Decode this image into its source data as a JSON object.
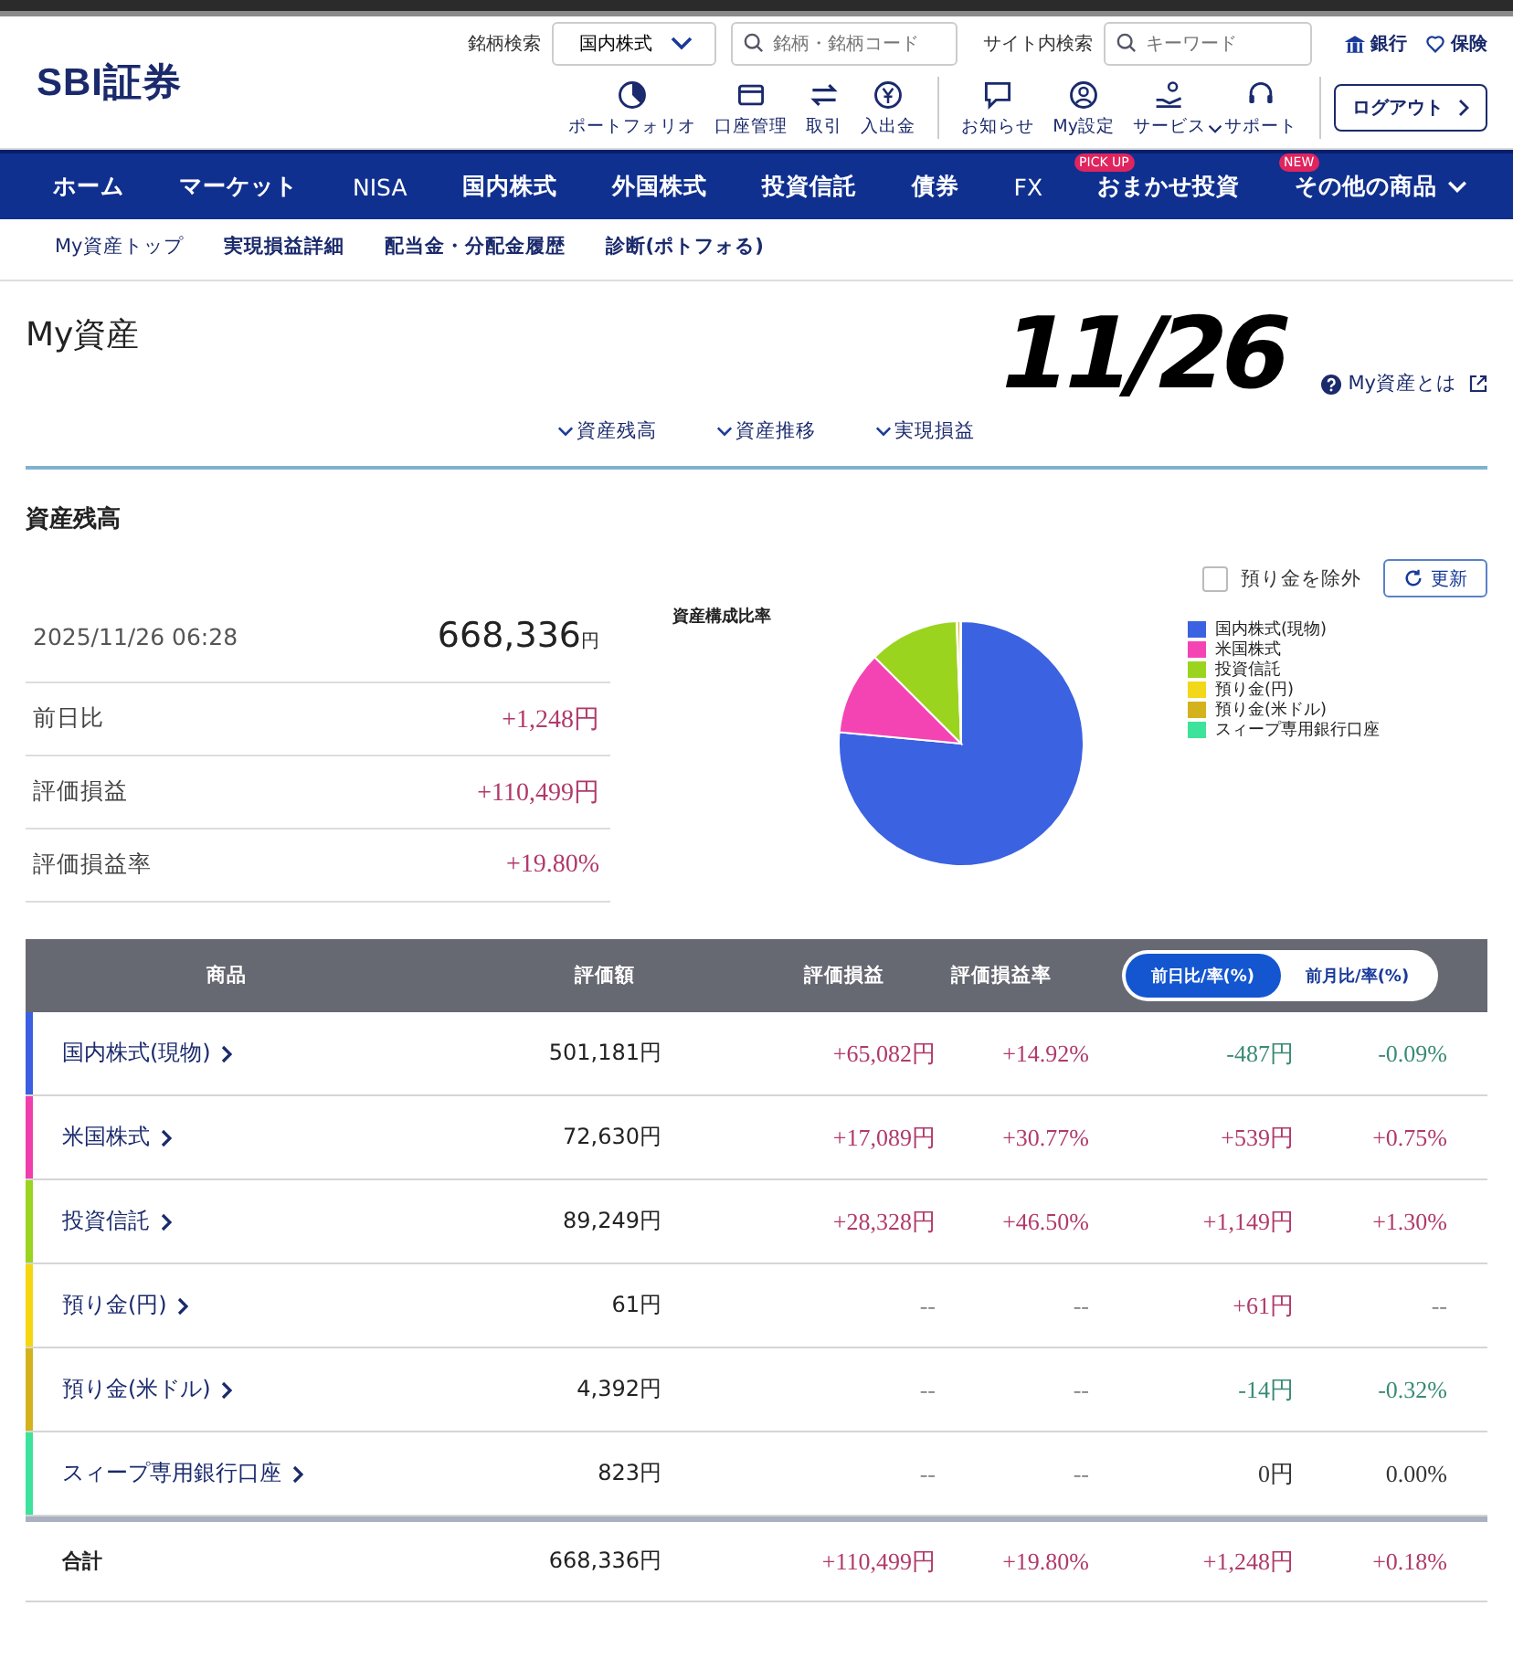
{
  "header": {
    "logo": "SBI証券",
    "stock_search": {
      "label": "銘柄検索",
      "market": "国内株式",
      "placeholder": "銘柄・銘柄コード"
    },
    "site_search": {
      "label": "サイト内検索",
      "placeholder": "キーワード"
    },
    "links": [
      {
        "label": "銀行",
        "kind": "bank"
      },
      {
        "label": "保険",
        "kind": "insurance"
      }
    ],
    "tools": [
      {
        "label": "ポートフォリオ",
        "kind": "portfolio"
      },
      {
        "label": "口座管理",
        "kind": "card"
      },
      {
        "label": "取引",
        "kind": "trade"
      },
      {
        "label": "入出金",
        "kind": "yen"
      },
      {
        "label": "お知らせ",
        "kind": "notice"
      },
      {
        "label": "My設定",
        "kind": "user"
      },
      {
        "label": "サービス",
        "kind": "service"
      },
      {
        "label": "サポート",
        "kind": "support"
      }
    ],
    "logout": "ログアウト"
  },
  "nav": [
    {
      "label": "ホーム"
    },
    {
      "label": "マーケット"
    },
    {
      "label": "NISA"
    },
    {
      "label": "国内株式"
    },
    {
      "label": "外国株式"
    },
    {
      "label": "投資信託"
    },
    {
      "label": "債券"
    },
    {
      "label": "FX"
    },
    {
      "label": "おまかせ投資",
      "badge": "PICK UP"
    },
    {
      "label": "その他の商品",
      "badge": "NEW"
    }
  ],
  "subnav": [
    "My資産トップ",
    "実現損益詳細",
    "配当金・分配金履歴",
    "診断(ポトフォる)"
  ],
  "note": "11/26",
  "page_title": "My資産",
  "help_link": "My資産とは",
  "anchors": [
    "資産残高",
    "資産推移",
    "実現損益"
  ],
  "section_title": "資産残高",
  "exclude_deposit": {
    "label": "預り金を除外",
    "checked": false
  },
  "refresh": "更新",
  "summary": {
    "datetime": "2025/11/26 06:28",
    "total": "668,336",
    "unit": "円",
    "rows": [
      {
        "label": "前日比",
        "value": "+1,248円"
      },
      {
        "label": "評価損益",
        "value": "+110,499円"
      },
      {
        "label": "評価損益率",
        "value": "+19.80%"
      }
    ]
  },
  "pie": {
    "title": "資産構成比率",
    "legend": [
      {
        "label": "国内株式(現物)",
        "color": "#3b62e0"
      },
      {
        "label": "米国株式",
        "color": "#f444b4"
      },
      {
        "label": "投資信託",
        "color": "#9ad41f"
      },
      {
        "label": "預り金(円)",
        "color": "#f2d818"
      },
      {
        "label": "預り金(米ドル)",
        "color": "#d4b21c"
      },
      {
        "label": "スィープ専用銀行口座",
        "color": "#3de39a"
      }
    ]
  },
  "table": {
    "columns": [
      "商品",
      "評価額",
      "評価損益",
      "評価損益率"
    ],
    "toggle": [
      {
        "label": "前日比/率(%)",
        "selected": true
      },
      {
        "label": "前月比/率(%)",
        "selected": false
      }
    ],
    "rows": [
      {
        "color": "#3b5fe0",
        "cells": [
          {
            "text": "国内株式(現物)",
            "kind": "name"
          },
          {
            "text": "501,181円",
            "kind": "amount"
          },
          {
            "text": "+65,082円",
            "color": "#b03a6b"
          },
          {
            "text": "+14.92%",
            "color": "#b03a6b"
          },
          {
            "text": "-487円",
            "color": "#3a8a76"
          },
          {
            "text": "-0.09%",
            "color": "#3a8a76"
          }
        ]
      },
      {
        "color": "#f03fac",
        "cells": [
          {
            "text": "米国株式",
            "kind": "name"
          },
          {
            "text": "72,630円",
            "kind": "amount"
          },
          {
            "text": "+17,089円",
            "color": "#b03a6b"
          },
          {
            "text": "+30.77%",
            "color": "#b03a6b"
          },
          {
            "text": "+539円",
            "color": "#b03a6b"
          },
          {
            "text": "+0.75%",
            "color": "#b03a6b"
          }
        ]
      },
      {
        "color": "#9ad41f",
        "cells": [
          {
            "text": "投資信託",
            "kind": "name"
          },
          {
            "text": "89,249円",
            "kind": "amount"
          },
          {
            "text": "+28,328円",
            "color": "#b03a6b"
          },
          {
            "text": "+46.50%",
            "color": "#b03a6b"
          },
          {
            "text": "+1,149円",
            "color": "#b03a6b"
          },
          {
            "text": "+1.30%",
            "color": "#b03a6b"
          }
        ]
      },
      {
        "color": "#f5d60f",
        "cells": [
          {
            "text": "預り金(円)",
            "kind": "name"
          },
          {
            "text": "61円",
            "kind": "amount"
          },
          {
            "text": "--",
            "color": "#888888"
          },
          {
            "text": "--",
            "color": "#888888"
          },
          {
            "text": "+61円",
            "color": "#b03a6b"
          },
          {
            "text": "--",
            "color": "#888888"
          }
        ]
      },
      {
        "color": "#d4b21c",
        "cells": [
          {
            "text": "預り金(米ドル)",
            "kind": "name"
          },
          {
            "text": "4,392円",
            "kind": "amount"
          },
          {
            "text": "--",
            "color": "#888888"
          },
          {
            "text": "--",
            "color": "#888888"
          },
          {
            "text": "-14円",
            "color": "#3a8a76"
          },
          {
            "text": "-0.32%",
            "color": "#3a8a76"
          }
        ]
      },
      {
        "color": "#3de39a",
        "cells": [
          {
            "text": "スィープ専用銀行口座",
            "kind": "name"
          },
          {
            "text": "823円",
            "kind": "amount"
          },
          {
            "text": "--",
            "color": "#888888"
          },
          {
            "text": "--",
            "color": "#888888"
          },
          {
            "text": "0円",
            "color": "#333333"
          },
          {
            "text": "0.00%",
            "color": "#333333"
          }
        ]
      }
    ],
    "total": {
      "cells": [
        {
          "text": "合計",
          "kind": "label"
        },
        {
          "text": "668,336円",
          "kind": "amount"
        },
        {
          "text": "+110,499円",
          "color": "#b03a6b"
        },
        {
          "text": "+19.80%",
          "color": "#b03a6b"
        },
        {
          "text": "+1,248円",
          "color": "#b03a6b"
        },
        {
          "text": "+0.18%",
          "color": "#b03a6b"
        }
      ]
    }
  }
}
